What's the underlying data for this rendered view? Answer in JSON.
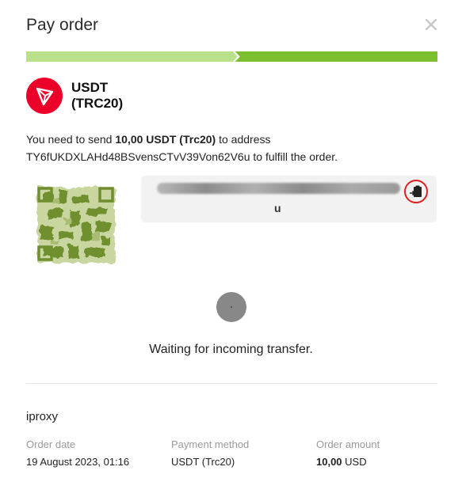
{
  "header": {
    "title": "Pay order"
  },
  "progress": {
    "step": 2,
    "total_steps": 2
  },
  "coin": {
    "name": "USDT (TRC20)"
  },
  "instructions": {
    "prefix": "You need to send ",
    "amount": "10,00 USDT (Trc20)",
    "middle": " to address ",
    "address": "TY6fUKDXLAHd48BSvensCTvV39Von62V6u",
    "suffix": " to fulfill the order."
  },
  "address_box": {
    "visible_tail": "u"
  },
  "status": {
    "waiting_text": "Waiting for incoming transfer."
  },
  "merchant": {
    "name": "iproxy"
  },
  "order_info": [
    {
      "label": "Order date",
      "value": "19 August 2023, 01:16"
    },
    {
      "label": "Payment method",
      "value": "USDT (Trc20)"
    },
    {
      "label": "Order amount",
      "amount": "10,00",
      "currency": " USD"
    }
  ],
  "colors": {
    "progress_done": "#b9e08a",
    "progress_current": "#7bbf2e",
    "tron_red": "#eb0029",
    "highlight": "#e02020"
  },
  "icons": {
    "close": "close-icon",
    "coin": "tron-logo-icon",
    "copy": "clipboard-copy-icon"
  }
}
